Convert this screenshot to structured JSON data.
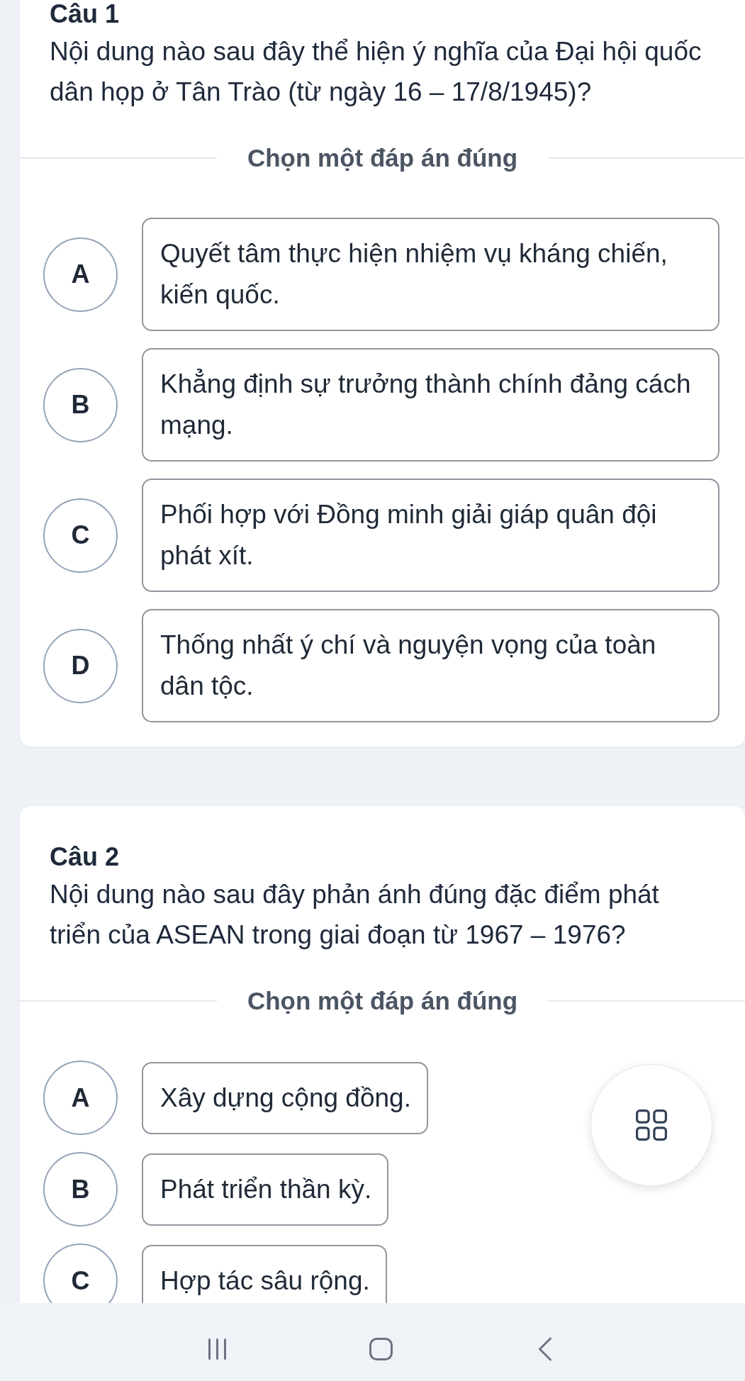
{
  "questions": [
    {
      "title": "Câu 1",
      "text": "Nội dung nào sau đây thể hiện ý nghĩa của Đại hội quốc dân họp ở Tân Trào (từ ngày 16 – 17/8/1945)?",
      "prompt": "Chọn một đáp án đúng",
      "options": [
        {
          "letter": "A",
          "text": "Quyết tâm thực hiện nhiệm vụ kháng chiến, kiến quốc.",
          "selected": false
        },
        {
          "letter": "B",
          "text": "Khẳng định sự trưởng thành chính đảng cách mạng.",
          "selected": false
        },
        {
          "letter": "C",
          "text": "Phối hợp với Đồng minh giải giáp quân đội phát xít.",
          "selected": false
        },
        {
          "letter": "D",
          "text": "Thống nhất ý chí và nguyện vọng của toàn dân tộc.",
          "selected": false
        }
      ]
    },
    {
      "title": "Câu 2",
      "text": "Nội dung nào sau đây phản ánh đúng đặc điểm phát triển của ASEAN trong giai đoạn từ 1967 – 1976?",
      "prompt": "Chọn một đáp án đúng",
      "options": [
        {
          "letter": "A",
          "text": "Xây dựng cộng đồng.",
          "selected": false
        },
        {
          "letter": "B",
          "text": "Phát triển thần kỳ.",
          "selected": false
        },
        {
          "letter": "C",
          "text": "Hợp tác sâu rộng.",
          "selected": false
        }
      ]
    }
  ]
}
